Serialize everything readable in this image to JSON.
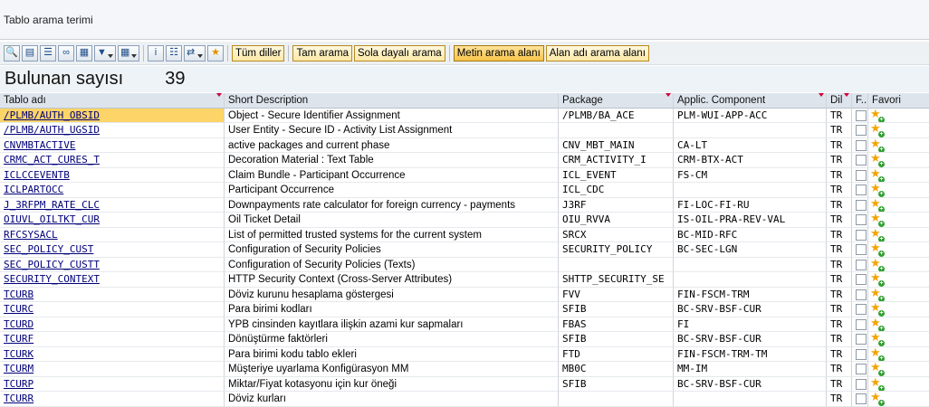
{
  "title_bar": {
    "title": "Tablo arama terimi"
  },
  "toolbar": {
    "icons": [
      "details-icon",
      "print-icon",
      "filter-icon",
      "binoculars-icon",
      "layout-icon",
      "funnel-icon",
      "columns-icon",
      "info-icon",
      "export-icon",
      "transfer-icon",
      "favorite-icon"
    ],
    "buttons": [
      {
        "label": "Tüm diller",
        "active": false
      },
      {
        "label": "Tam arama",
        "active": false
      },
      {
        "label": "Sola dayalı arama",
        "active": false
      },
      {
        "label": "Metin arama alanı",
        "active": true
      },
      {
        "label": "Alan adı arama alanı",
        "active": false
      }
    ]
  },
  "result": {
    "label": "Bulunan sayısı",
    "count": "39"
  },
  "table": {
    "headers": [
      "Tablo adı",
      "Short Description",
      "Package",
      "Applic. Component",
      "Dil",
      "F..",
      "Favori"
    ],
    "rows": [
      [
        "/PLMB/AUTH_OBSID",
        "Object - Secure Identifier Assignment",
        "/PLMB/BA_ACE",
        "PLM-WUI-APP-ACC",
        "TR"
      ],
      [
        "/PLMB/AUTH_UGSID",
        "User Entity - Secure ID - Activity List Assignment",
        "",
        "",
        "TR"
      ],
      [
        "CNVMBTACTIVE",
        "active packages and current phase",
        "CNV_MBT_MAIN",
        "CA-LT",
        "TR"
      ],
      [
        "CRMC_ACT_CURES_T",
        "Decoration Material : Text Table",
        "CRM_ACTIVITY_I",
        "CRM-BTX-ACT",
        "TR"
      ],
      [
        "ICLCCEVENTB",
        "Claim Bundle - Participant Occurrence",
        "ICL_EVENT",
        "FS-CM",
        "TR"
      ],
      [
        "ICLPARTOCC",
        "Participant Occurrence",
        "ICL_CDC",
        "",
        "TR"
      ],
      [
        "J_3RFPM_RATE_CLC",
        "Downpayments rate calculator for foreign currency - payments",
        "J3RF",
        "FI-LOC-FI-RU",
        "TR"
      ],
      [
        "OIUVL_OILTKT_CUR",
        "Oil Ticket Detail",
        "OIU_RVVA",
        "IS-OIL-PRA-REV-VAL",
        "TR"
      ],
      [
        "RFCSYSACL",
        "List of permitted trusted systems for the current system",
        "SRCX",
        "BC-MID-RFC",
        "TR"
      ],
      [
        "SEC_POLICY_CUST",
        "Configuration of Security Policies",
        "SECURITY_POLICY",
        "BC-SEC-LGN",
        "TR"
      ],
      [
        "SEC_POLICY_CUSTT",
        "Configuration of Security Policies (Texts)",
        "",
        "",
        "TR"
      ],
      [
        "SECURITY_CONTEXT",
        "HTTP Security Context (Cross-Server Attributes)",
        "SHTTP_SECURITY_SE",
        "",
        "TR"
      ],
      [
        "TCURB",
        "Döviz kurunu hesaplama göstergesi",
        "FVV",
        "FIN-FSCM-TRM",
        "TR"
      ],
      [
        "TCURC",
        "Para birimi kodları",
        "SFIB",
        "BC-SRV-BSF-CUR",
        "TR"
      ],
      [
        "TCURD",
        "YPB cinsinden kayıtlara ilişkin azami kur sapmaları",
        "FBAS",
        "FI",
        "TR"
      ],
      [
        "TCURF",
        "Dönüştürme faktörleri",
        "SFIB",
        "BC-SRV-BSF-CUR",
        "TR"
      ],
      [
        "TCURK",
        "Para birimi kodu tablo ekleri",
        "FTD",
        "FIN-FSCM-TRM-TM",
        "TR"
      ],
      [
        "TCURM",
        "Müşteriye uyarlama Konfigürasyon MM",
        "MB0C",
        "MM-IM",
        "TR"
      ],
      [
        "TCURP",
        "Miktar/Fiyat kotasyonu için kur öneği",
        "SFIB",
        "BC-SRV-BSF-CUR",
        "TR"
      ],
      [
        "TCURR",
        "Döviz kurları",
        "",
        "",
        "TR"
      ]
    ]
  },
  "colors": {
    "selected_cell": "#fcd467",
    "link": "#00007a",
    "header_bg": "#dde4ec",
    "sort_marker": "#d0003a"
  }
}
